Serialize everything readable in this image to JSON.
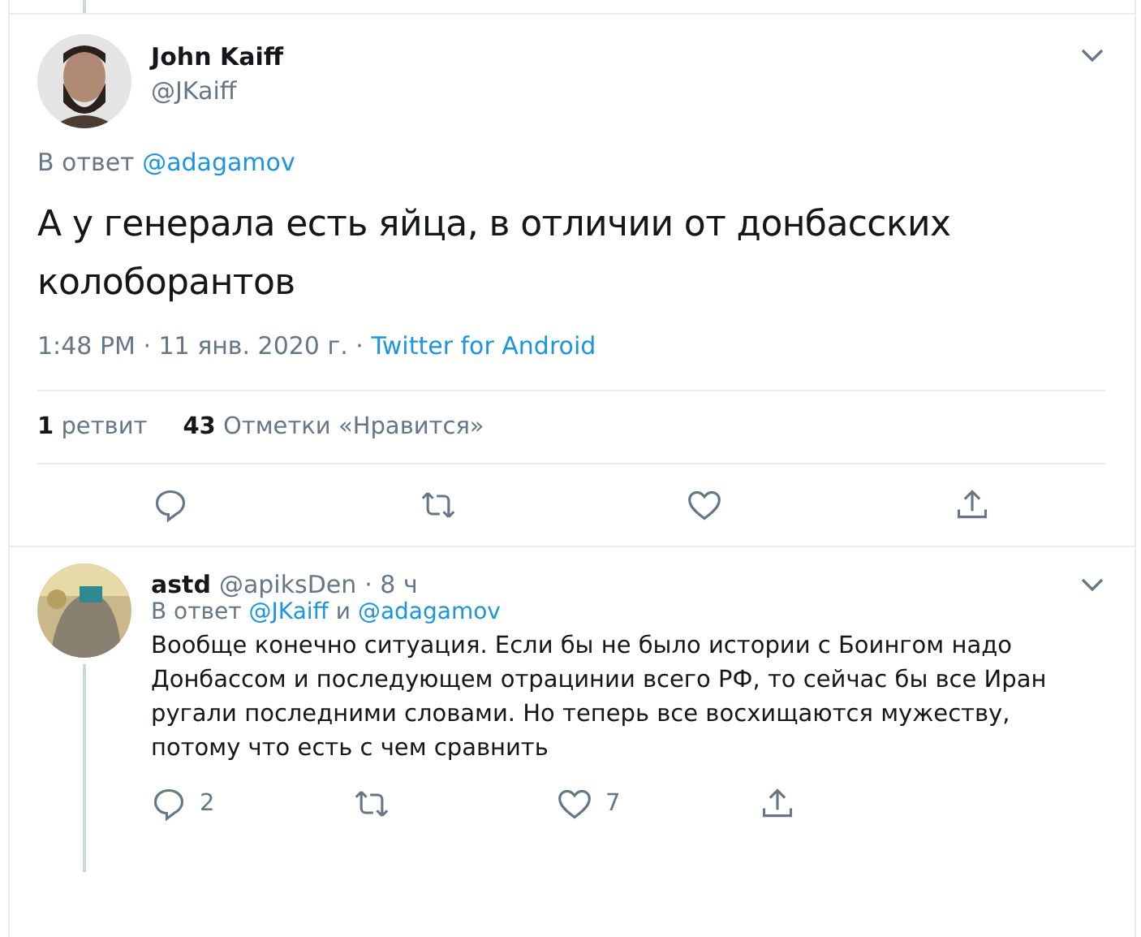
{
  "tweet": {
    "name": "John Kaiff",
    "handle": "@JKaiff",
    "reply_to": {
      "prefix": "В ответ",
      "mentions": [
        "@adagamov"
      ]
    },
    "text": "А у генерала есть яйца, в отличии от донбасских колоборантов",
    "time": "1:48 PM · 11 янв. 2020 г. ·",
    "source": "Twitter for Android",
    "stats": [
      "**1** ретвит",
      "**43** Отметки «Нравится»"
    ]
  },
  "reply": {
    "name": "astd",
    "handle": "@apiksDen",
    "age": "· 8 ч",
    "reply_to": {
      "prefix": "В ответ",
      "mentions": [
        "@JKaiff",
        "@adagamov"
      ],
      "joiner": "и"
    },
    "text": "Вообще конечно ситуация. Если бы не было истории с Боингом надо Донбассом и последующем отрацинии всего РФ, то сейчас бы все Иран ругали последними словами. Но теперь все восхищаются мужеству, потому что есть с чем сравнить",
    "replies": "2",
    "likes": "7"
  }
}
